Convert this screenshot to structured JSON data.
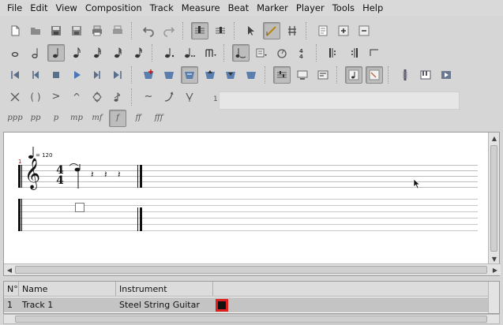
{
  "menubar": {
    "items": [
      "File",
      "Edit",
      "View",
      "Composition",
      "Track",
      "Measure",
      "Beat",
      "Marker",
      "Player",
      "Tools",
      "Help"
    ]
  },
  "toolbar": {
    "row1": [
      "new-file-icon",
      "open-file-icon",
      "save-icon",
      "save-as-icon",
      "print-icon",
      "print-preview-icon",
      "undo-icon",
      "redo-icon",
      "score-view-icon",
      "tab-view-icon",
      "edit-mode-icon",
      "natural-key-icon",
      "ties-icon",
      "document-properties-icon",
      "add-measure-icon",
      "remove-measure-icon"
    ],
    "dynamics": [
      "ppp",
      "pp",
      "p",
      "mp",
      "mf",
      "f",
      "ff",
      "fff"
    ],
    "selected_dynamic": "f"
  },
  "score": {
    "tempo_value": "= 120",
    "measure_number": "1",
    "time_signature": {
      "top": "4",
      "bottom": "4"
    },
    "extra_marker": "1"
  },
  "tracks": {
    "headers": [
      "N°",
      "Name",
      "Instrument"
    ],
    "rows": [
      {
        "number": "1",
        "name": "Track 1",
        "instrument": "Steel String Guitar",
        "color": "#e02020"
      }
    ]
  }
}
